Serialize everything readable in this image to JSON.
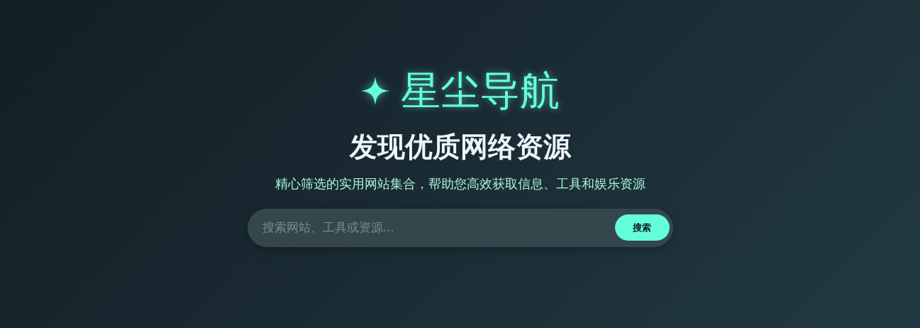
{
  "brand": {
    "name": "星尘导航"
  },
  "hero": {
    "title": "发现优质网络资源",
    "subtitle": "精心筛选的实用网站集合，帮助您高效获取信息、工具和娱乐资源"
  },
  "search": {
    "placeholder": "搜索网站、工具或资源...",
    "button": "搜索"
  }
}
